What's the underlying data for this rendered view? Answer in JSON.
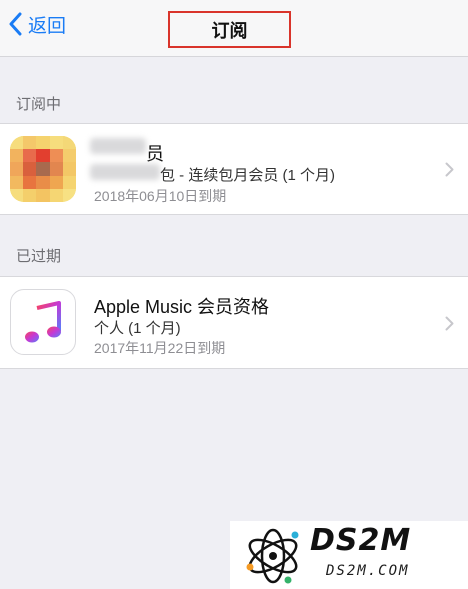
{
  "navbar": {
    "back_label": "返回",
    "title": "订阅"
  },
  "sections": {
    "active_header": "订阅中",
    "expired_header": "已过期"
  },
  "active_subscription": {
    "name_visible": "员",
    "plan": "包 - 连续包月会员 (1 个月)",
    "expiry": "2018年06月10日到期"
  },
  "expired_subscription": {
    "name": "Apple Music 会员资格",
    "plan": "个人 (1 个月)",
    "expiry": "2017年11月22日到期"
  },
  "watermark": {
    "brand": "DS2M",
    "domain": "DS2M.COM"
  },
  "colors": {
    "accent": "#1a7cf5",
    "highlight_box": "#d9342b",
    "background": "#efeff4"
  },
  "icons": {
    "back": "chevron-left-icon",
    "row": "chevron-right-icon",
    "music": "music-note-icon"
  }
}
